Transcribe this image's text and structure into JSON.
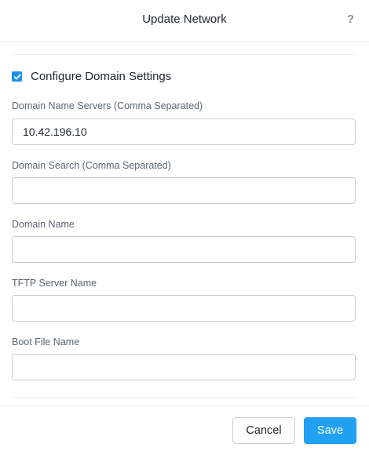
{
  "dialog": {
    "title": "Update Network",
    "help_label": "?"
  },
  "domain_settings": {
    "checkbox_label": "Configure Domain Settings",
    "checked": true
  },
  "fields": {
    "dns": {
      "label": "Domain Name Servers (Comma Separated)",
      "value": "10.42.196.10"
    },
    "search": {
      "label": "Domain Search (Comma Separated)",
      "value": ""
    },
    "domain": {
      "label": "Domain Name",
      "value": ""
    },
    "tftp": {
      "label": "TFTP Server Name",
      "value": ""
    },
    "boot": {
      "label": "Boot File Name",
      "value": ""
    }
  },
  "footer": {
    "cancel_label": "Cancel",
    "save_label": "Save"
  },
  "colors": {
    "accent": "#22a0f2",
    "checkbox": "#1e90e8"
  },
  "icons": {
    "help": "help-icon",
    "check": "checkmark-icon"
  }
}
